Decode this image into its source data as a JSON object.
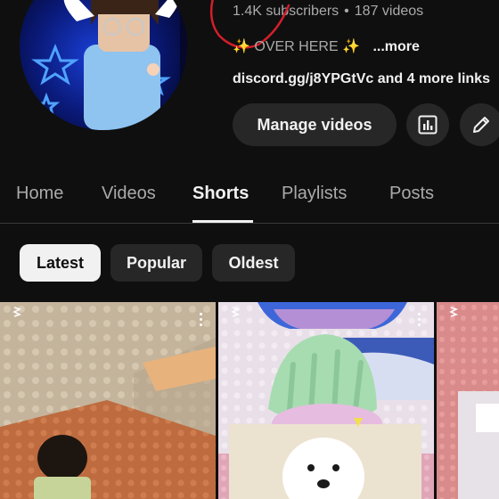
{
  "channel": {
    "subscribers": "1.4K subscribers",
    "separator": "•",
    "videos": "187 videos",
    "description_sparkle": "✨",
    "description_text": "OVER HERE",
    "more_label": "...more",
    "links": "discord.gg/j8YPGtVc and 4 more links",
    "manage_videos_label": "Manage videos",
    "analytics_icon": "analytics-icon",
    "edit_icon": "pencil-icon"
  },
  "tabs": [
    {
      "label": "Home"
    },
    {
      "label": "Videos"
    },
    {
      "label": "Shorts",
      "active": true
    },
    {
      "label": "Playlists"
    },
    {
      "label": "Posts"
    }
  ],
  "filters": [
    {
      "label": "Latest",
      "selected": true
    },
    {
      "label": "Popular"
    },
    {
      "label": "Oldest"
    }
  ],
  "colors": {
    "background": "#0f0f0f",
    "chip": "#272727",
    "text_primary": "#f1f1f1",
    "text_secondary": "#aaaaaa",
    "annotation": "#d21f2a"
  }
}
